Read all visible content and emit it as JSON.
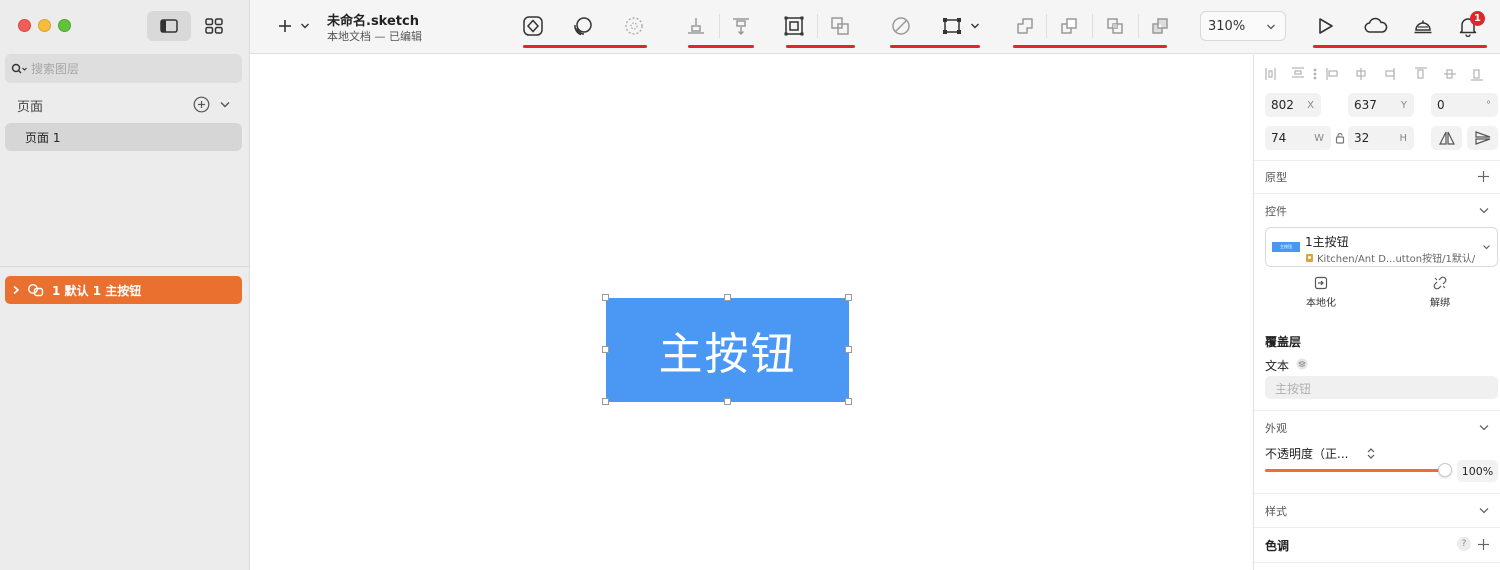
{
  "window": {
    "doc_title": "未命名.sketch",
    "doc_subtitle": "本地文档 — 已编辑",
    "zoom": "310%",
    "notification_count": "1"
  },
  "sidebar": {
    "search_placeholder": "搜索图层",
    "pages_header": "页面",
    "pages": [
      {
        "label": "页面 1"
      }
    ],
    "layers": [
      {
        "label": "1 默认 1 主按钮"
      }
    ]
  },
  "canvas": {
    "button_text": "主按钮"
  },
  "inspector": {
    "x": "802",
    "x_unit": "X",
    "y": "637",
    "y_unit": "Y",
    "rotation": "0",
    "rotation_unit": "°",
    "w": "74",
    "w_unit": "W",
    "h": "32",
    "h_unit": "H",
    "prototype_label": "原型",
    "component_label": "控件",
    "symbol": {
      "thumb_text": "主按钮",
      "name": "1主按钮",
      "path": "Kitchen/Ant D...utton按钮/1默认/"
    },
    "detach_local": "本地化",
    "detach_unlink": "解绑",
    "overrides_label": "覆盖层",
    "text_label": "文本",
    "text_value": "主按钮",
    "appearance_label": "外观",
    "opacity_mode": "不透明度（正...",
    "opacity_value": "100%",
    "opacity_fraction": 1.0,
    "style_label": "样式",
    "tint_label": "色调",
    "help_glyph": "?"
  },
  "colors": {
    "accent": "#ea7030",
    "button_blue": "#4a98f3",
    "annotation_red": "#e0262d"
  }
}
